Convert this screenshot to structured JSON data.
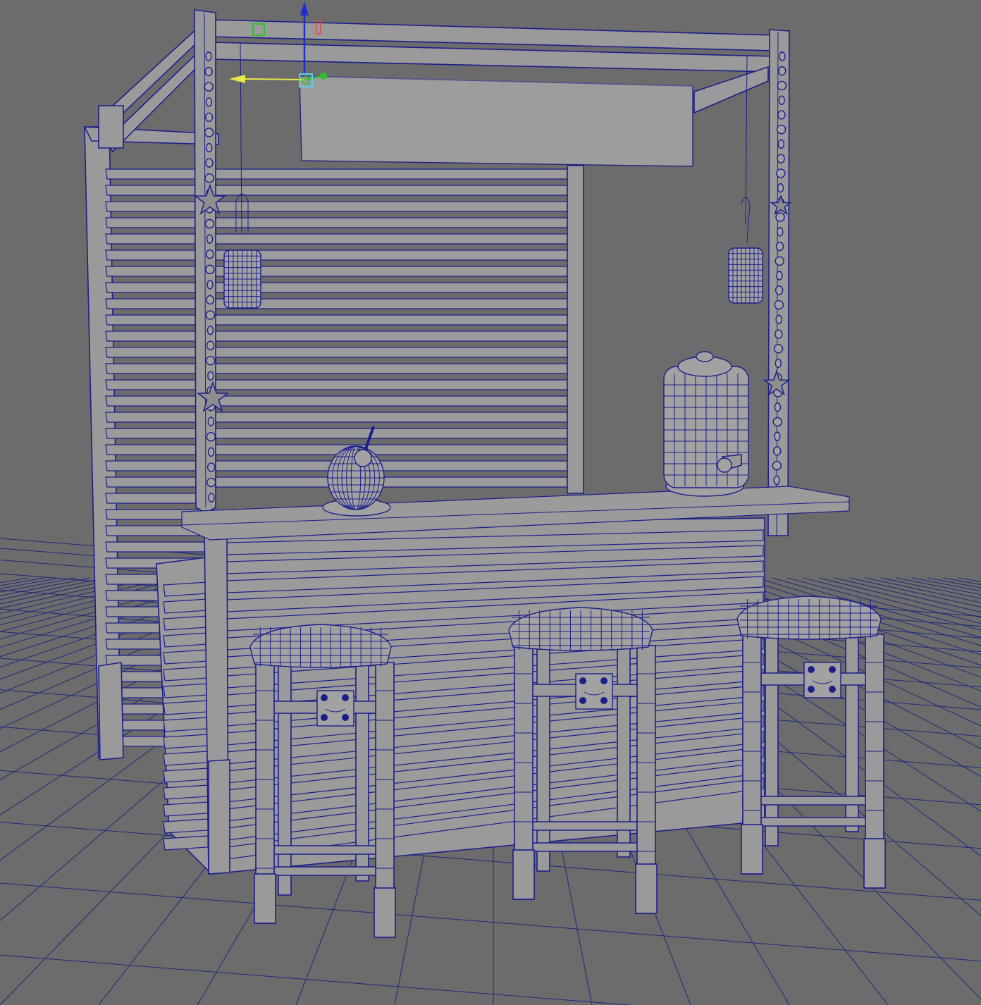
{
  "app": {
    "type": "3d-viewport",
    "view": "perspective",
    "display_mode": "wireframe-on-shaded"
  },
  "scene": {
    "objects": [
      "beach-bar-frame",
      "slatted-back-wall",
      "bar-counter",
      "bar-countertop",
      "sign-board",
      "hanging-jar-lantern-left",
      "hanging-jar-lantern-right",
      "seashell-garland-left",
      "seashell-garland-right",
      "coconut-drink",
      "drink-dispenser",
      "bar-stool-1",
      "bar-stool-2",
      "bar-stool-3"
    ],
    "selected_object": "sign-board"
  },
  "manipulator": {
    "tool": "move-tool",
    "axes": [
      "x",
      "y",
      "z"
    ]
  },
  "colors": {
    "background": "#6c6c6c",
    "wireframe": "#1b1f8a",
    "surface": "#9b9b9b",
    "axis_x": "#e8e84a",
    "axis_y": "#1e2fd0",
    "axis_z": "#30c030",
    "pivot": "#5ad1e6"
  }
}
